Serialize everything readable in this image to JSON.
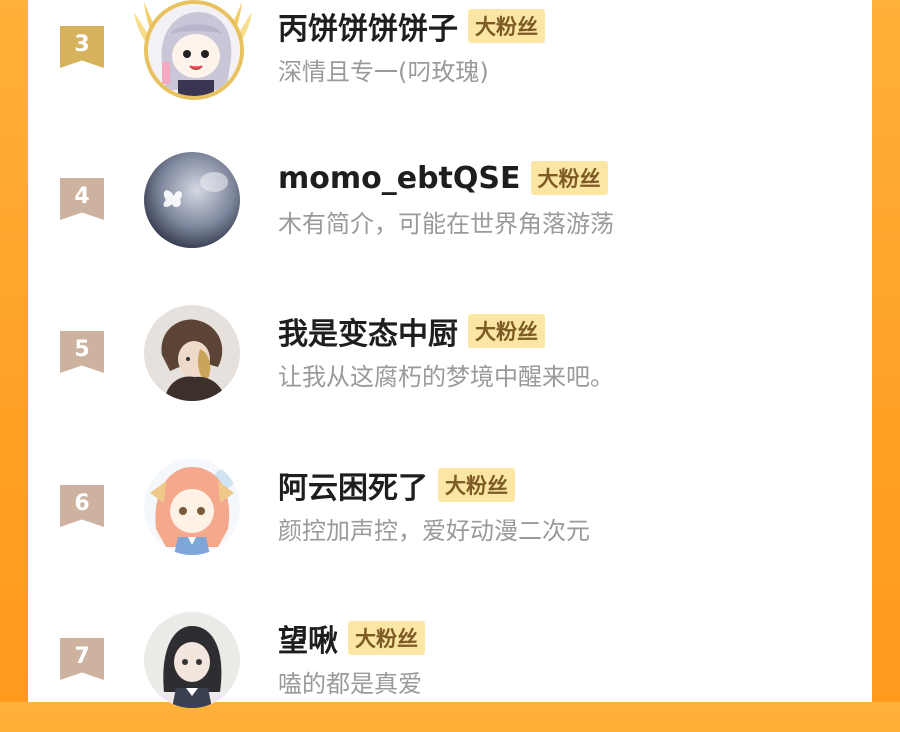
{
  "colors": {
    "background": "#ffa126",
    "card": "#ffffff",
    "badge_bg": "#fbe7a3",
    "badge_text": "#7d5a26",
    "rank_gold": "#d6b25c",
    "rank_default": "#cdb39f",
    "bio_text": "#9a9a9a"
  },
  "fans": [
    {
      "rank": "3",
      "name": "丙饼饼饼饼子",
      "badge": "大粉丝",
      "bio": "深情且专一(叼玫瑰)",
      "avatar_icon": "anime-girl-avatar-icon",
      "frame_icon": "golden-wings-frame-icon"
    },
    {
      "rank": "4",
      "name": "momo_ebtQSE",
      "badge": "大粉丝",
      "bio": "木有简介，可能在世界角落游荡",
      "avatar_icon": "night-sky-butterfly-avatar-icon"
    },
    {
      "rank": "5",
      "name": "我是变态中厨",
      "badge": "大粉丝",
      "bio": "让我从这腐朽的梦境中醒来吧。",
      "avatar_icon": "sketch-character-avatar-icon"
    },
    {
      "rank": "6",
      "name": "阿云困死了",
      "badge": "大粉丝",
      "bio": "颜控加声控，爱好动漫二次元",
      "avatar_icon": "pink-hair-girl-avatar-icon"
    },
    {
      "rank": "7",
      "name": "望啾",
      "badge": "大粉丝",
      "bio": "嗑的都是真爱",
      "avatar_icon": "dark-hair-girl-avatar-icon"
    }
  ]
}
